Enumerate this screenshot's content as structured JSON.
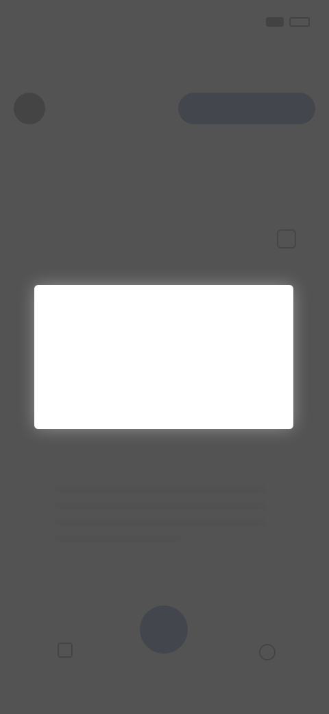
{
  "status_bar": {
    "time": ""
  },
  "header": {
    "title": ""
  },
  "profile": {
    "name": "",
    "action_button_label": ""
  },
  "tabs": [
    {
      "label": ""
    },
    {
      "label": ""
    }
  ],
  "section": {
    "title": ""
  },
  "card": {
    "title": ""
  },
  "bottom_nav": {
    "left_label": ""
  },
  "dialog": {
    "title": "",
    "message": "",
    "cancel_label": "",
    "confirm_label": ""
  },
  "colors": {
    "accent": "#1e5aa8",
    "danger": "#e53935",
    "overlay": "#464646"
  },
  "icons": {
    "signal": "signal-icon",
    "battery": "battery-icon",
    "section_action": "edit-icon",
    "nav_left": "home-icon",
    "nav_right": "profile-icon"
  }
}
